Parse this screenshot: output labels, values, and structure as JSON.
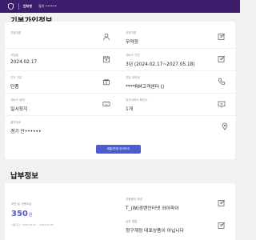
{
  "header": {
    "icon": "shield-icon",
    "brand": "인터넷",
    "location": "경기 ••••••"
  },
  "subscription": {
    "title": "기본가입정보",
    "fields": [
      {
        "label": "가입자명",
        "value": "",
        "icon": "person-icon"
      },
      {
        "label": "사업자명",
        "value": "무약정",
        "icon": "edit-icon"
      },
      {
        "label": "가입일",
        "value": "2024.02.17",
        "icon": "calendar-icon"
      },
      {
        "label": "서비스 기간",
        "value": "3년 (2024.02.17~2027.05.18)",
        "icon": "edit-icon"
      },
      {
        "label": "주거 구분",
        "value": "단품",
        "icon": "gift-icon"
      },
      {
        "label": "가입 대리점",
        "value": "****RM고객센터 ()",
        "icon": "phone-icon"
      },
      {
        "label": "서비스 상태",
        "value": "일시정지",
        "icon": "keyboard-icon"
      },
      {
        "label": "유선서비스 회선수",
        "value": "1개",
        "icon": "tv-icon"
      },
      {
        "label": "설치장소",
        "value": "경기 안••••••",
        "icon": "location-pin-icon"
      }
    ],
    "change_button": "재통/변경 이어드리"
  },
  "payment": {
    "title": "납부정보",
    "monthly_label": "이번 달 사용요금",
    "amount": "350",
    "amount_unit": "원",
    "period": "사용기간 : 2023.04.01 ~ 2023.04.30",
    "fields": [
      {
        "label": "사용중인 요금",
        "value": "T_(W)광랜인터넷 와이파이",
        "icon": "edit-icon"
      },
      {
        "label": "납부 방법",
        "value": "청구계정 대표상품이 아닙니다",
        "icon": "edit-icon"
      }
    ]
  },
  "colors": {
    "topbar": "#3c1d6b",
    "accent": "#4c5bd4",
    "background": "#f1f1f4"
  }
}
